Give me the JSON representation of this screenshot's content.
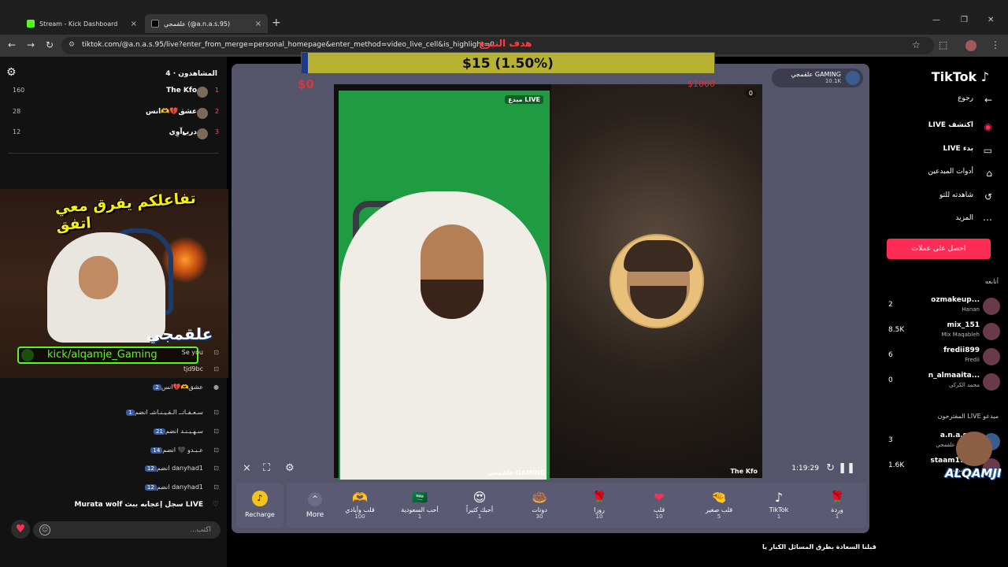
{
  "browser": {
    "tabs": [
      {
        "label": "Stream - Kick Dashboard"
      },
      {
        "label": "علقمجي (@a.n.a.s.95)",
        "active": true
      }
    ],
    "url": "tiktok.com/@a.n.a.s.95/live?enter_from_merge=personal_homepage&enter_method=video_live_cell&is_highlight=0"
  },
  "chat": {
    "viewers_label": "المشاهدون · 4",
    "ranking": [
      {
        "pos": "1",
        "name": "The Kfo",
        "count": "160"
      },
      {
        "pos": "2",
        "name": "عشق💔🫶انس",
        "count": "28"
      },
      {
        "pos": "3",
        "name": "دريۓآوِي",
        "count": "12"
      }
    ],
    "overlay_banner": "تفاعلكم يفرق معي اتفق",
    "overlay_name": "علقمجي",
    "kick_link": "kick/alqamje_Gaming",
    "messages": [
      {
        "text": "Se you",
        "badge": ""
      },
      {
        "text": "tjd9bc",
        "badge": ""
      },
      {
        "text": "عشق🫶💔انس",
        "badge": "2"
      },
      {
        "text": "سـعـفـاتــ الـقـيـنـاشـ انضم",
        "badge": "1"
      },
      {
        "text": "سـهـيـنـد انضم",
        "badge": "21"
      },
      {
        "text": "عـبـدو 🖤 انضم",
        "badge": "14"
      },
      {
        "text": "danyhad1 انضم",
        "badge": "12"
      },
      {
        "text": "danyhad1 انضم",
        "badge": "12"
      }
    ],
    "system_message": "Murata wolf سجل إعجابه ببث LIVE",
    "input_placeholder": "اكتب..."
  },
  "goal": {
    "title": "هدف التبرع",
    "text": "$15 (1.50%)",
    "progress": 0.015,
    "min": "$0",
    "max": "$1000"
  },
  "live": {
    "streamer_name": "علقمجي GAMING",
    "streamer_followers": "10.1K",
    "left_tag": "مبدع LIVE",
    "left_name": "علقمجي GAMING",
    "right_score": "0",
    "right_name": "The Kfo",
    "timer": "1:19:29",
    "caption": "قبلنا السعادة بطرق المسائل الكبار يا",
    "recharge_label": "Recharge",
    "more_label": "More",
    "gifts": [
      {
        "name": "قلب وأيادي",
        "price": "100",
        "icon": "🫶"
      },
      {
        "name": "أحب السعودية",
        "price": "1",
        "icon": "🇸🇦"
      },
      {
        "name": "أحبك كثيراً",
        "price": "1",
        "icon": "😍"
      },
      {
        "name": "دونات",
        "price": "30",
        "icon": "🍩"
      },
      {
        "name": "روزا",
        "price": "10",
        "icon": "🌹"
      },
      {
        "name": "قلب",
        "price": "10",
        "icon": "❤"
      },
      {
        "name": "قلب صغير",
        "price": "5",
        "icon": "🤏"
      },
      {
        "name": "TikTok",
        "price": "1",
        "icon": "♪"
      },
      {
        "name": "وردة",
        "price": "1",
        "icon": "🌹"
      }
    ]
  },
  "sidebar": {
    "logo": "TikTok",
    "nav": [
      {
        "label": "رجوع",
        "icon": "←"
      },
      {
        "label": "اكتشف LIVE",
        "icon": "◉"
      },
      {
        "label": "بدء LIVE",
        "icon": "▭"
      },
      {
        "label": "أدوات المبدعين",
        "icon": "⌂"
      },
      {
        "label": "شاهدته للتو",
        "icon": "↺"
      },
      {
        "label": "المزيد",
        "icon": "⋯"
      }
    ],
    "cta": "احصل على عملات",
    "following_title": "أتابعه",
    "following": [
      {
        "name": "ozmakeup...",
        "sub": "Hanan",
        "count": "2"
      },
      {
        "name": "mix_151",
        "sub": "Mix Maqableh",
        "count": "8.5K"
      },
      {
        "name": "fredii899",
        "sub": "Fredii",
        "count": "6"
      },
      {
        "name": "n_almaaita...",
        "sub": "محمد الكركي",
        "count": "0"
      }
    ],
    "suggested_title": "مبدعو LIVE المقترحون",
    "suggested": [
      {
        "name": "a.n.a.s.95",
        "sub": "علقمجي GAMING",
        "count": "3"
      },
      {
        "name": "staam19834",
        "sub": "ركن الصرفة",
        "count": "1.6K"
      }
    ],
    "watermark": "ALQAMJI"
  }
}
